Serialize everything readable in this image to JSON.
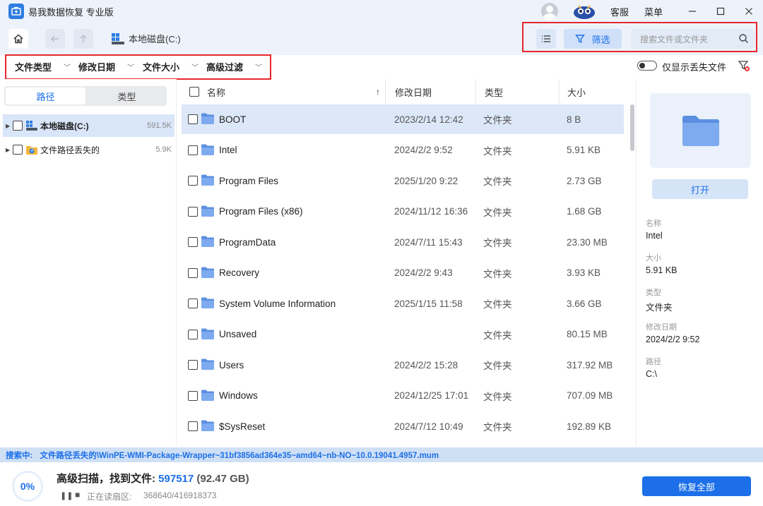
{
  "app": {
    "title": "易我数据恢复 专业版"
  },
  "titlebar": {
    "service": "客服",
    "menu": "菜单"
  },
  "nav": {
    "location": "本地磁盘(C:)"
  },
  "toolbar": {
    "filter_label": "筛选",
    "search_placeholder": "搜索文件或文件夹"
  },
  "filters": {
    "file_type": "文件类型",
    "modified_date": "修改日期",
    "file_size": "文件大小",
    "advanced": "高级过滤",
    "show_lost_only": "仅显示丢失文件"
  },
  "left": {
    "tabs": [
      "路径",
      "类型"
    ],
    "tree": [
      {
        "label": "本地磁盘(C:)",
        "count": "591.5K"
      },
      {
        "label": "文件路径丢失的",
        "count": "5.9K"
      }
    ]
  },
  "table": {
    "columns": {
      "name": "名称",
      "date": "修改日期",
      "type": "类型",
      "size": "大小"
    },
    "rows": [
      {
        "name": "BOOT",
        "date": "2023/2/14 12:42",
        "type": "文件夹",
        "size": "8 B"
      },
      {
        "name": "Intel",
        "date": "2024/2/2 9:52",
        "type": "文件夹",
        "size": "5.91 KB"
      },
      {
        "name": "Program Files",
        "date": "2025/1/20 9:22",
        "type": "文件夹",
        "size": "2.73 GB"
      },
      {
        "name": "Program Files (x86)",
        "date": "2024/11/12 16:36",
        "type": "文件夹",
        "size": "1.68 GB"
      },
      {
        "name": "ProgramData",
        "date": "2024/7/11 15:43",
        "type": "文件夹",
        "size": "23.30 MB"
      },
      {
        "name": "Recovery",
        "date": "2024/2/2 9:43",
        "type": "文件夹",
        "size": "3.93 KB"
      },
      {
        "name": "System Volume Information",
        "date": "2025/1/15 11:58",
        "type": "文件夹",
        "size": "3.66 GB"
      },
      {
        "name": "Unsaved",
        "date": "",
        "type": "文件夹",
        "size": "80.15 MB"
      },
      {
        "name": "Users",
        "date": "2024/2/2 15:28",
        "type": "文件夹",
        "size": "317.92 MB"
      },
      {
        "name": "Windows",
        "date": "2024/12/25 17:01",
        "type": "文件夹",
        "size": "707.09 MB"
      },
      {
        "name": "$SysReset",
        "date": "2024/7/12 10:49",
        "type": "文件夹",
        "size": "192.89 KB"
      }
    ]
  },
  "details": {
    "open_label": "打开",
    "name_label": "名称",
    "name_value": "Intel",
    "size_label": "大小",
    "size_value": "5.91 KB",
    "type_label": "类型",
    "type_value": "文件夹",
    "date_label": "修改日期",
    "date_value": "2024/2/2 9:52",
    "path_label": "路径",
    "path_value": "C:\\"
  },
  "scan": {
    "searching_label": "搜索中:",
    "searching_path": "文件路径丢失的\\WinPE-WMI-Package-Wrapper~31bf3856ad364e35~amd64~nb-NO~10.0.19041.4957.mum",
    "progress": "0%",
    "title": "高级扫描，找到文件:",
    "found_count": "597517",
    "found_size": "(92.47 GB)",
    "reading_label": "正在读扇区:",
    "reading_value": "368640/416918373",
    "recover_all": "恢复全部"
  },
  "colors": {
    "accent": "#1c6fe8",
    "highlight": "#e8262c",
    "selected_row": "#dce7f8"
  }
}
